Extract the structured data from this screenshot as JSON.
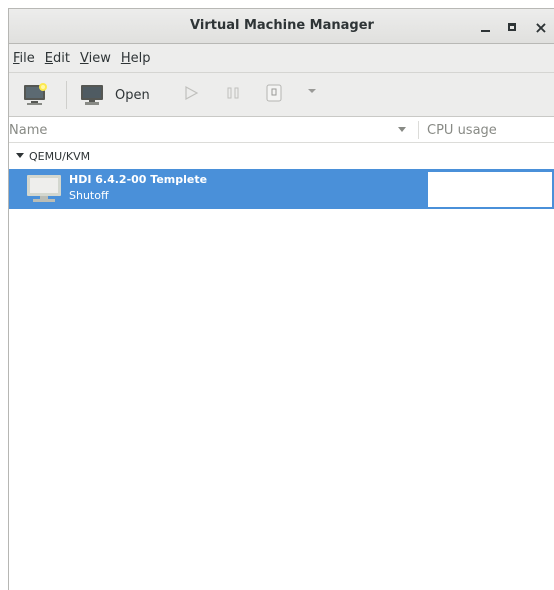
{
  "window": {
    "title": "Virtual Machine Manager",
    "controls": [
      "minimize",
      "maximize",
      "close"
    ],
    "close_glyph": "×"
  },
  "menubar": {
    "items": [
      {
        "mnemonic": "F",
        "rest": "ile"
      },
      {
        "mnemonic": "E",
        "rest": "dit"
      },
      {
        "mnemonic": "V",
        "rest": "iew"
      },
      {
        "mnemonic": "H",
        "rest": "elp"
      }
    ]
  },
  "toolbar": {
    "new_icon": "new-vm-icon",
    "open_label": "Open",
    "open_icon": "monitor-icon",
    "run_icon": "play-icon",
    "pause_icon": "pause-icon",
    "shutdown_icon": "shutdown-icon",
    "dropdown_icon": "dropdown-arrow-icon"
  },
  "columns": {
    "name": "Name",
    "cpu": "CPU usage"
  },
  "tree": {
    "group": "QEMU/KVM",
    "vms": [
      {
        "name": "HDI 6.4.2-00 Templete",
        "status": "Shutoff",
        "selected": true
      }
    ]
  },
  "colors": {
    "selection": "#4a90d9",
    "chrome": "#ededec",
    "text": "#2e3436"
  }
}
